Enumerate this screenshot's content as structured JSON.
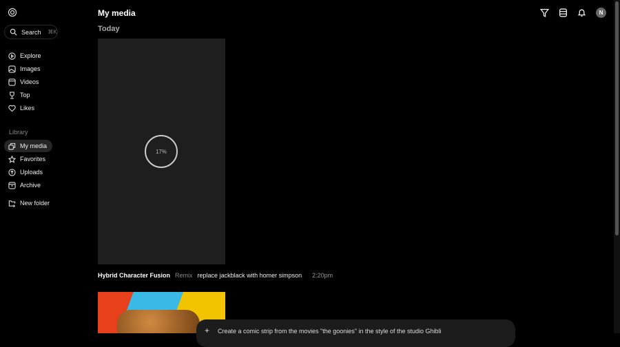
{
  "sidebar": {
    "search_label": "Search",
    "search_shortcut": "⌘K",
    "items": [
      {
        "label": "Explore"
      },
      {
        "label": "Images"
      },
      {
        "label": "Videos"
      },
      {
        "label": "Top"
      },
      {
        "label": "Likes"
      }
    ],
    "library_heading": "Library",
    "library": [
      {
        "label": "My media"
      },
      {
        "label": "Favorites"
      },
      {
        "label": "Uploads"
      },
      {
        "label": "Archive"
      }
    ],
    "new_folder": "New folder"
  },
  "header": {
    "title": "My media",
    "avatar_initial": "N"
  },
  "main": {
    "section": "Today",
    "progress": "17%",
    "progress_value": 0.17,
    "item": {
      "name": "Hybrid Character Fusion",
      "type": "Remix",
      "prompt": "replace jackblack with homer simpson",
      "time": "2:20pm"
    }
  },
  "composer": {
    "text": "Create a comic strip from the movies \"the goonies\" in the style of the studio Ghibli"
  }
}
